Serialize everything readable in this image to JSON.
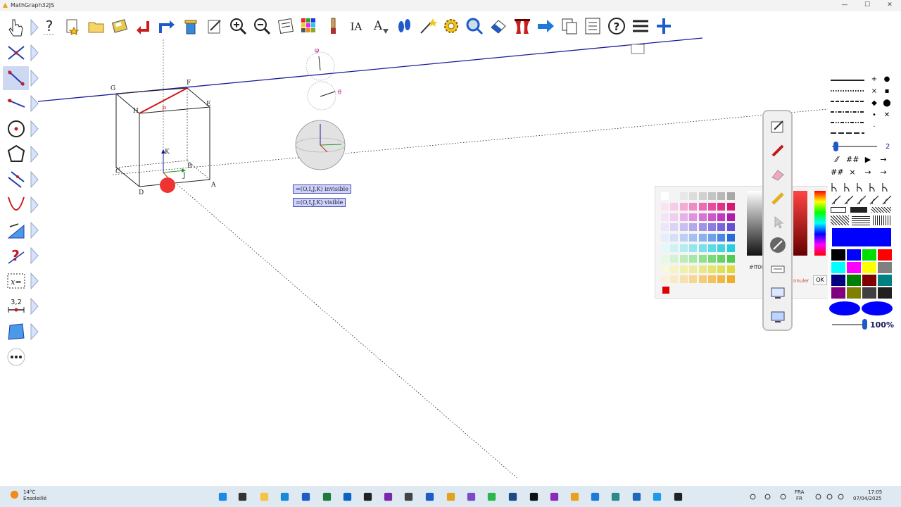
{
  "window": {
    "title": "MathGraph32JS",
    "minimize": "—",
    "maximize": "☐",
    "close": "✕"
  },
  "toolbar": {
    "items": [
      "help-button",
      "new-figure-button",
      "open-button",
      "save-button",
      "undo-button",
      "redo-button",
      "delete-button",
      "edit-button",
      "zoom-in-button",
      "zoom-out-button",
      "protocol-button",
      "palette-button",
      "brush-button",
      "text-button",
      "label-button",
      "footprint-button",
      "magic-button",
      "settings-button",
      "search-button",
      "erase-button",
      "curtain-button",
      "forward-button",
      "copy-button",
      "list-button",
      "question-button",
      "menu-button",
      "plus-button"
    ],
    "help_label": "?",
    "text_label": "IA",
    "label_label": "A"
  },
  "left_tools": {
    "numeric_label": "3,2",
    "formula_label": "x="
  },
  "figure": {
    "points": {
      "A": "A",
      "B": "B",
      "C": "C",
      "D": "D",
      "E": "E",
      "F": "F",
      "G": "G",
      "H": "H",
      "I": "I",
      "J": "J",
      "K": "K",
      "P": "P"
    },
    "phi": "φ",
    "theta": "ϑ",
    "btn_invisible": "=(O,I,J,K) invisible",
    "btn_visible": "=(O,I,J,K) visible"
  },
  "color_panel": {
    "hex_value": "#ff00",
    "cancel_label": "nnuler",
    "ok_label": "OK",
    "selected_color": "#e00000"
  },
  "style_panel": {
    "thickness_value": "2",
    "opacity_value": "100%"
  },
  "taskbar": {
    "weather_temp": "14°C",
    "weather_desc": "Ensoleillé",
    "lang_top": "FRA",
    "lang_bottom": "FR",
    "time": "17:05",
    "date": "07/04/2025"
  }
}
